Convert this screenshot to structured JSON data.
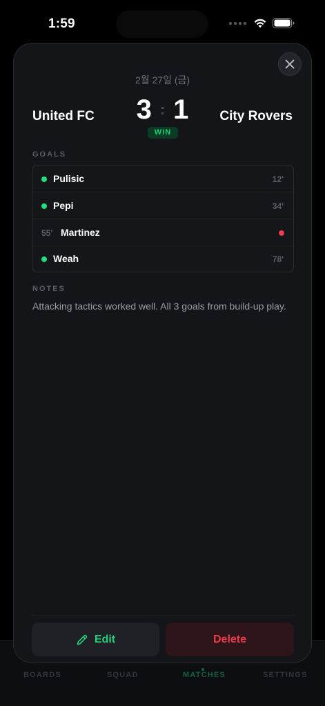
{
  "status_bar": {
    "time": "1:59"
  },
  "tab_bar": {
    "tabs": [
      {
        "label": "BOARDS",
        "active": false
      },
      {
        "label": "SQUAD",
        "active": false
      },
      {
        "label": "MATCHES",
        "active": true
      },
      {
        "label": "SETTINGS",
        "active": false
      }
    ]
  },
  "match": {
    "date": "2월 27일 (금)",
    "home_team": "United FC",
    "away_team": "City Rovers",
    "home_score": "3",
    "separator": ":",
    "away_score": "1",
    "result": "WIN"
  },
  "goals": {
    "label": "GOALS",
    "items": [
      {
        "player": "Pulisic",
        "minute": "12'",
        "side": "home"
      },
      {
        "player": "Pepi",
        "minute": "34'",
        "side": "home"
      },
      {
        "player": "Martinez",
        "minute": "55'",
        "side": "away"
      },
      {
        "player": "Weah",
        "minute": "78'",
        "side": "home"
      }
    ]
  },
  "notes": {
    "label": "NOTES",
    "text": "Attacking tactics worked well. All 3 goals from build-up play."
  },
  "actions": {
    "edit_label": "Edit",
    "delete_label": "Delete"
  },
  "icons": {
    "close": "close-icon",
    "edit": "pencil-icon",
    "signal": "signal-dots-icon",
    "wifi": "wifi-icon",
    "battery": "battery-icon"
  },
  "colors": {
    "accent_green": "#21d07a",
    "danger_red": "#ef3a4a",
    "sheet_bg": "#141519"
  }
}
